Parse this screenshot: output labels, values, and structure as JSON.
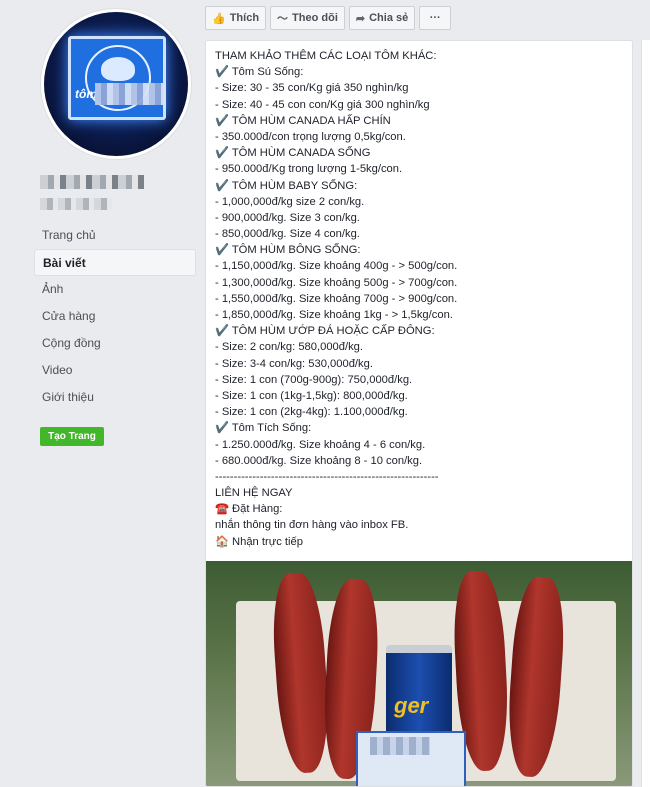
{
  "sidebar": {
    "nav_items": [
      "Trang chủ",
      "Bài viết",
      "Ảnh",
      "Cửa hàng",
      "Cộng đồng",
      "Video",
      "Giới thiệu"
    ],
    "active_item": "Bài viết",
    "create_page_label": "Tạo Trang"
  },
  "avatar": {
    "sign_text": "tôm"
  },
  "actions": {
    "like_label": "Thích",
    "follow_label": "Theo dõi",
    "share_label": "Chia sẻ",
    "more_label": "···"
  },
  "post": {
    "lines": [
      "THAM KHẢO THÊM CÁC LOẠI TÔM KHÁC:",
      "✔️ Tôm Sú Sống:",
      "- Size: 30 - 35 con/Kg giá 350 nghìn/kg",
      "- Size: 40 - 45 con con/Kg giá 300 nghìn/kg",
      "✔️ TÔM HÙM CANADA HẤP CHÍN",
      "- 350.000đ/con trọng lượng 0,5kg/con.",
      "✔️ TÔM HÙM CANADA SỐNG",
      "- 950.000đ/Kg trong lượng 1-5kg/con.",
      "✔️ TÔM HÙM BABY SỐNG:",
      "- 1,000,000đ/kg size 2 con/kg.",
      "- 900,000đ/kg. Size 3 con/kg.",
      "- 850,000đ/kg. Size 4 con/kg.",
      "✔️ TÔM HÙM BÔNG SỐNG:",
      "- 1,150,000đ/kg. Size khoảng 400g - > 500g/con.",
      "- 1,300,000đ/kg. Size khoảng 500g - > 700g/con.",
      "- 1,550,000đ/kg. Size khoảng 700g - > 900g/con.",
      "- 1,850,000đ/kg. Size khoảng 1kg - > 1,5kg/con.",
      "✔️ TÔM HÙM ƯỚP ĐÁ HOẶC CẤP ĐÔNG:",
      "- Size: 2 con/kg: 580,000đ/kg.",
      "- Size: 3-4 con/kg: 530,000đ/kg.",
      "- Size: 1 con (700g-900g): 750,000đ/kg.",
      "- Size: 1 con (1kg-1,5kg): 800,000đ/kg.",
      "- Size: 1 con (2kg-4kg): 1.100,000đ/kg.",
      "✔️ Tôm Tích Sống:",
      "- 1.250.000đ/kg. Size khoảng 4 - 6 con/kg.",
      "- 680.000đ/kg. Size khoảng 8 - 10 con/kg.",
      "------------------------------------------------------------",
      "LIÊN HỆ NGAY",
      "☎️ Đặt Hàng: ",
      "nhắn thông tin đơn hàng vào inbox FB.",
      "🏠 Nhận trực tiếp"
    ]
  },
  "photo": {
    "can_text": "ger"
  },
  "colors": {
    "accent": "#3b5998",
    "create_button": "#42b72a",
    "page_bg": "#e9ebee"
  }
}
